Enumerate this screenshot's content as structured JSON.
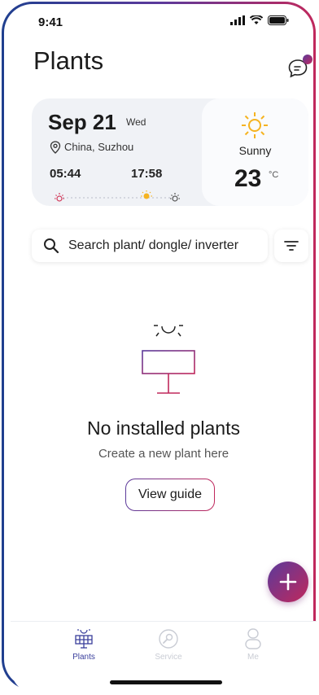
{
  "status_bar": {
    "time": "9:41"
  },
  "header": {
    "title": "Plants",
    "message_icon": "message-icon"
  },
  "weather": {
    "date": "Sep 21",
    "weekday": "Wed",
    "location": "China, Suzhou",
    "sunrise": "05:44",
    "sunset": "17:58",
    "condition": "Sunny",
    "temperature": "23",
    "unit": "°C"
  },
  "search": {
    "placeholder": "Search plant/ dongle/ inverter"
  },
  "empty_state": {
    "title": "No installed plants",
    "subtitle": "Create a new plant here",
    "button_label": "View guide"
  },
  "tabs": [
    {
      "label": "Plants",
      "icon": "solar-panel-icon",
      "active": true
    },
    {
      "label": "Service",
      "icon": "wrench-icon",
      "active": false
    },
    {
      "label": "Me",
      "icon": "user-icon",
      "active": false
    }
  ],
  "colors": {
    "accent_start": "#5b3a9b",
    "accent_end": "#c0285c",
    "active_tab": "#3a3f9c",
    "inactive_tab": "#c9ccd4"
  }
}
